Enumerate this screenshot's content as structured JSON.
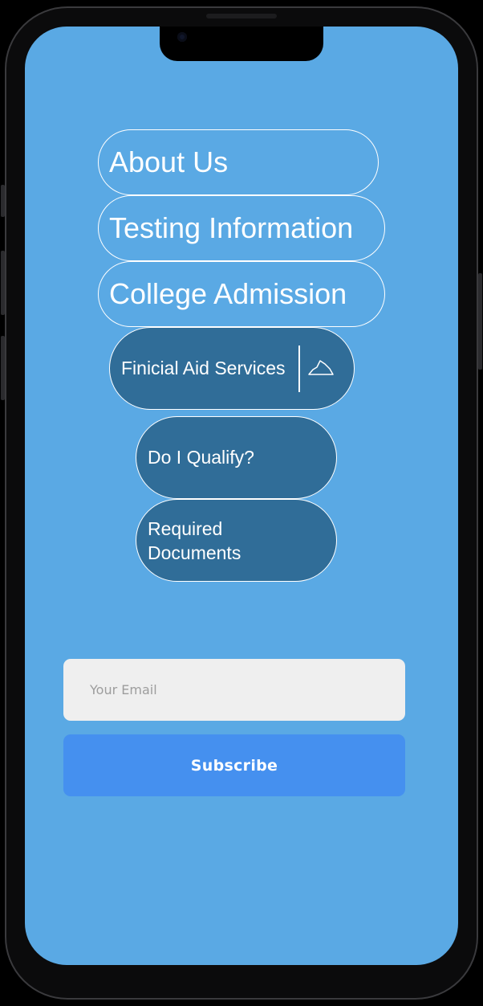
{
  "menu": {
    "about_us": "About Us",
    "testing_information": "Testing Information",
    "college_admission": "College Admission",
    "financial_aid": {
      "label": "Finicial Aid Services",
      "toggle_icon": "cloud-icon"
    },
    "do_i_qualify": "Do I Qualify?",
    "required_documents": "Required Documents"
  },
  "newsletter": {
    "email_placeholder": "Your Email",
    "email_value": "",
    "subscribe_label": "Subscribe"
  },
  "colors": {
    "screen_background": "#5aa9e4",
    "dark_pill": "#306d98",
    "subscribe_button": "#4590ef",
    "email_field": "#efefef"
  }
}
